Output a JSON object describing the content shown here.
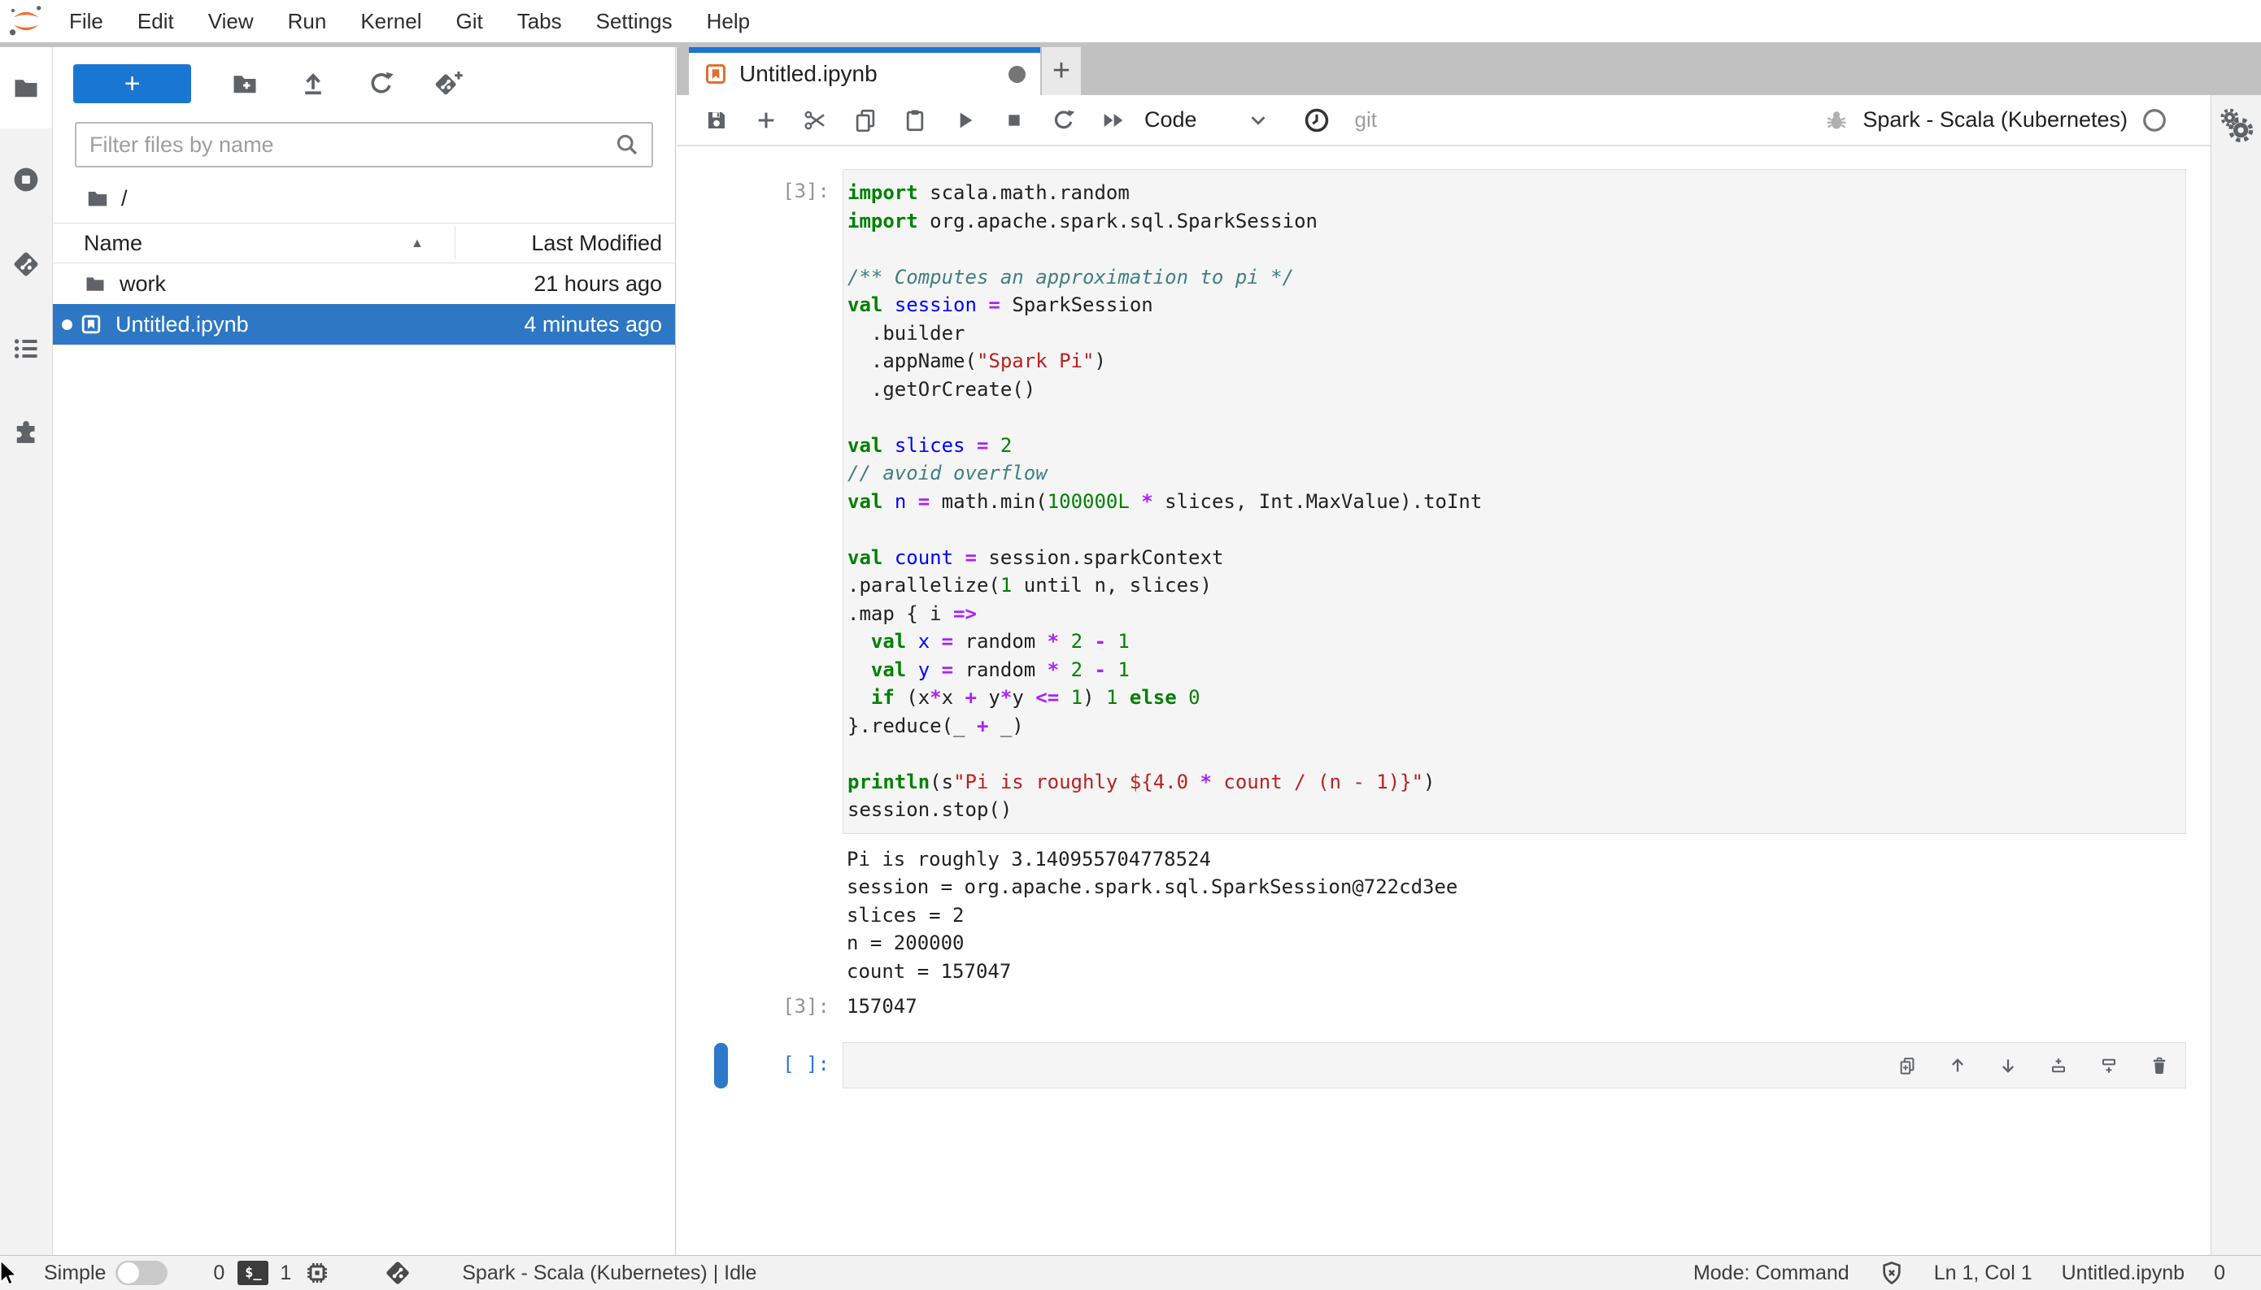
{
  "menu_bar": {
    "items": [
      "File",
      "Edit",
      "View",
      "Run",
      "Kernel",
      "Git",
      "Tabs",
      "Settings",
      "Help"
    ]
  },
  "activity_bar": {
    "tabs": [
      {
        "name": "file-browser",
        "icon": "folder",
        "active": true
      },
      {
        "name": "running-sessions",
        "icon": "stop-circle",
        "active": false
      },
      {
        "name": "git",
        "icon": "git-diamond",
        "active": false
      },
      {
        "name": "table-of-contents",
        "icon": "list",
        "active": false
      },
      {
        "name": "extensions",
        "icon": "puzzle",
        "active": false
      }
    ]
  },
  "file_browser": {
    "new_launcher_label": "+",
    "toolbar_icons": [
      {
        "name": "new-folder-button",
        "icon": "folder-plus"
      },
      {
        "name": "upload-button",
        "icon": "upload"
      },
      {
        "name": "refresh-button",
        "icon": "refresh"
      },
      {
        "name": "git-clone-button",
        "icon": "git-plus"
      }
    ],
    "filter_placeholder": "Filter files by name",
    "breadcrumb_root": "/",
    "columns": {
      "name": "Name",
      "last_modified": "Last Modified"
    },
    "files": [
      {
        "name": "work",
        "icon": "folder",
        "modified": "21 hours ago",
        "selected": false,
        "running": false
      },
      {
        "name": "Untitled.ipynb",
        "icon": "notebook",
        "modified": "4 minutes ago",
        "selected": true,
        "running": true
      }
    ]
  },
  "dock": {
    "tab": {
      "title": "Untitled.ipynb",
      "dirty": true
    },
    "new_tab_label": "+"
  },
  "notebook_toolbar": {
    "buttons": [
      {
        "name": "save-button",
        "icon": "floppy"
      },
      {
        "name": "insert-cell-button",
        "icon": "plus"
      },
      {
        "name": "cut-cells-button",
        "icon": "scissors"
      },
      {
        "name": "copy-cells-button",
        "icon": "copy"
      },
      {
        "name": "paste-cells-button",
        "icon": "clipboard"
      },
      {
        "name": "run-button",
        "icon": "play"
      },
      {
        "name": "interrupt-kernel-button",
        "icon": "square"
      },
      {
        "name": "restart-kernel-button",
        "icon": "refresh"
      },
      {
        "name": "restart-run-all-button",
        "icon": "fast-forward"
      }
    ],
    "cell_type": "Code",
    "git_label": "git",
    "kernel_name": "Spark - Scala (Kubernetes)"
  },
  "notebook": {
    "cells": [
      {
        "prompt": "[3]:",
        "code_lines": [
          [
            [
              "k",
              "import"
            ],
            [
              "p",
              " scala.math.random"
            ]
          ],
          [
            [
              "k",
              "import"
            ],
            [
              "p",
              " org.apache.spark.sql.SparkSession"
            ]
          ],
          [],
          [
            [
              "c",
              "/** Computes an approximation to pi */"
            ]
          ],
          [
            [
              "k",
              "val"
            ],
            [
              "p",
              " "
            ],
            [
              "d",
              "session"
            ],
            [
              "p",
              " "
            ],
            [
              "o",
              "="
            ],
            [
              "p",
              " SparkSession"
            ]
          ],
          [
            [
              "p",
              "  .builder"
            ]
          ],
          [
            [
              "p",
              "  .appName("
            ],
            [
              "s",
              "\"Spark Pi\""
            ],
            [
              "p",
              ")"
            ]
          ],
          [
            [
              "p",
              "  .getOrCreate()"
            ]
          ],
          [],
          [
            [
              "k",
              "val"
            ],
            [
              "p",
              " "
            ],
            [
              "d",
              "slices"
            ],
            [
              "p",
              " "
            ],
            [
              "o",
              "="
            ],
            [
              "p",
              " "
            ],
            [
              "n",
              "2"
            ]
          ],
          [
            [
              "c",
              "// avoid overflow"
            ]
          ],
          [
            [
              "k",
              "val"
            ],
            [
              "p",
              " "
            ],
            [
              "d",
              "n"
            ],
            [
              "p",
              " "
            ],
            [
              "o",
              "="
            ],
            [
              "p",
              " math.min("
            ],
            [
              "n",
              "100000L"
            ],
            [
              "p",
              " "
            ],
            [
              "o",
              "*"
            ],
            [
              "p",
              " slices, Int.MaxValue).toInt"
            ]
          ],
          [],
          [
            [
              "k",
              "val"
            ],
            [
              "p",
              " "
            ],
            [
              "d",
              "count"
            ],
            [
              "p",
              " "
            ],
            [
              "o",
              "="
            ],
            [
              "p",
              " session.sparkContext"
            ]
          ],
          [
            [
              "p",
              ".parallelize("
            ],
            [
              "n",
              "1"
            ],
            [
              "p",
              " until n, slices)"
            ]
          ],
          [
            [
              "p",
              ".map { i "
            ],
            [
              "o",
              "=>"
            ]
          ],
          [
            [
              "p",
              "  "
            ],
            [
              "k",
              "val"
            ],
            [
              "p",
              " "
            ],
            [
              "d",
              "x"
            ],
            [
              "p",
              " "
            ],
            [
              "o",
              "="
            ],
            [
              "p",
              " random "
            ],
            [
              "o",
              "*"
            ],
            [
              "p",
              " "
            ],
            [
              "n",
              "2"
            ],
            [
              "p",
              " "
            ],
            [
              "o",
              "-"
            ],
            [
              "p",
              " "
            ],
            [
              "n",
              "1"
            ]
          ],
          [
            [
              "p",
              "  "
            ],
            [
              "k",
              "val"
            ],
            [
              "p",
              " "
            ],
            [
              "d",
              "y"
            ],
            [
              "p",
              " "
            ],
            [
              "o",
              "="
            ],
            [
              "p",
              " random "
            ],
            [
              "o",
              "*"
            ],
            [
              "p",
              " "
            ],
            [
              "n",
              "2"
            ],
            [
              "p",
              " "
            ],
            [
              "o",
              "-"
            ],
            [
              "p",
              " "
            ],
            [
              "n",
              "1"
            ]
          ],
          [
            [
              "p",
              "  "
            ],
            [
              "k",
              "if"
            ],
            [
              "p",
              " (x"
            ],
            [
              "o",
              "*"
            ],
            [
              "p",
              "x "
            ],
            [
              "o",
              "+"
            ],
            [
              "p",
              " y"
            ],
            [
              "o",
              "*"
            ],
            [
              "p",
              "y "
            ],
            [
              "o",
              "<="
            ],
            [
              "p",
              " "
            ],
            [
              "n",
              "1"
            ],
            [
              "p",
              ") "
            ],
            [
              "n",
              "1"
            ],
            [
              "p",
              " "
            ],
            [
              "k",
              "else"
            ],
            [
              "p",
              " "
            ],
            [
              "n",
              "0"
            ]
          ],
          [
            [
              "p",
              "}.reduce(_ "
            ],
            [
              "o",
              "+"
            ],
            [
              "p",
              " _)"
            ]
          ],
          [],
          [
            [
              "k",
              "println"
            ],
            [
              "p",
              "(s"
            ],
            [
              "s",
              "\"Pi is roughly ${4.0 "
            ],
            [
              "o",
              "*"
            ],
            [
              "s",
              " count / (n - 1)}\""
            ],
            [
              "p",
              ")"
            ]
          ],
          [
            [
              "p",
              "session.stop()"
            ]
          ]
        ],
        "outputs": [
          "Pi is roughly 3.140955704778524",
          "session = org.apache.spark.sql.SparkSession@722cd3ee",
          "slices = 2",
          "n = 200000",
          "count = 157047"
        ],
        "result": {
          "prompt": "[3]:",
          "value": "157047"
        }
      },
      {
        "prompt": "[ ]:",
        "active": true
      }
    ],
    "cell_toolbar": [
      {
        "name": "duplicate-cell-button",
        "icon": "copy-plus"
      },
      {
        "name": "move-cell-up-button",
        "icon": "arrow-up"
      },
      {
        "name": "move-cell-down-button",
        "icon": "arrow-down"
      },
      {
        "name": "insert-cell-above-button",
        "icon": "insert-above"
      },
      {
        "name": "insert-cell-below-button",
        "icon": "insert-below"
      },
      {
        "name": "delete-cell-button",
        "icon": "trash"
      }
    ]
  },
  "status_bar": {
    "simple_label": "Simple",
    "terminals_count": "0",
    "terminal_badge": "$_",
    "kernels_count": "1",
    "kernel_status": "Spark - Scala (Kubernetes) | Idle",
    "mode": "Mode: Command",
    "cursor_position": "Ln 1, Col 1",
    "notebook_name": "Untitled.ipynb",
    "notifications_count": "0"
  },
  "icons": [
    "jupyter-logo",
    "search-icon",
    "sort-ascending-icon",
    "chevron-down-icon",
    "history-clock-icon",
    "bug-icon",
    "kernel-idle-circle-icon",
    "settings-gears-icon",
    "terminal-icon",
    "kernel-chip-icon",
    "git-branch-icon",
    "trust-shield-icon",
    "bell-icon",
    "mouse-cursor"
  ],
  "colors": {
    "brand_blue": "#1976d2",
    "selection_blue": "#2d77c4",
    "active_cell_blue": "#2d79c9",
    "tab_accent": "#1976d2",
    "icon_gray": "#5f6368",
    "jupyter_orange": "#ee7437"
  }
}
